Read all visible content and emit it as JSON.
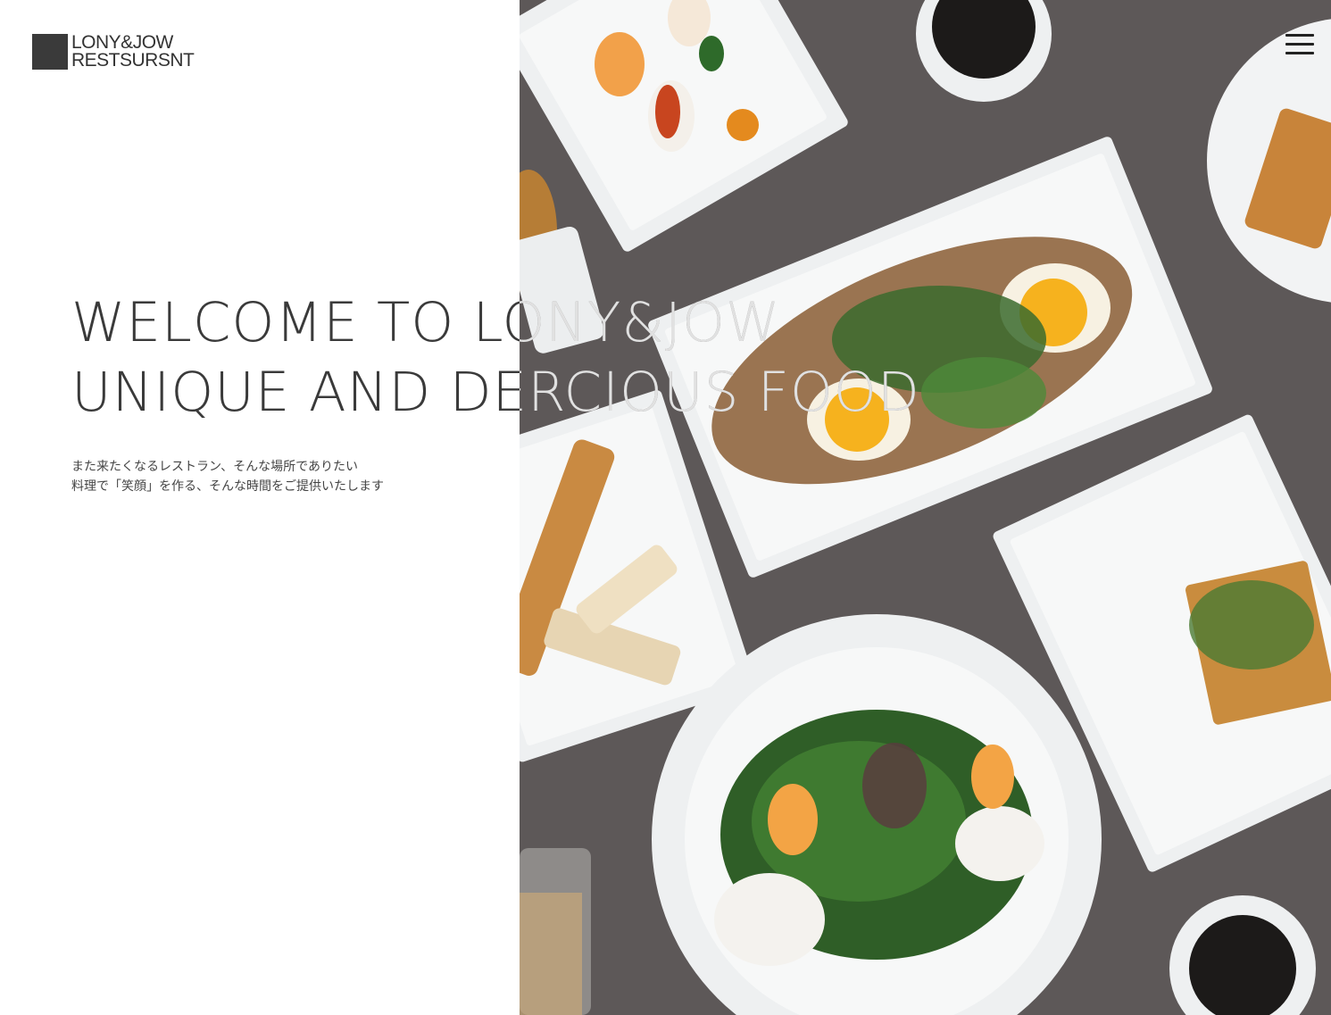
{
  "logo": {
    "line1": "LONY&JOW",
    "line2": "RESTSURSNT"
  },
  "hero": {
    "headline_line1": "WELCOME TO LONY&JOW",
    "headline_line2": "UNIQUE AND DERCIOUS FOOD",
    "tagline_line1": "また来たくなるレストラン、そんな場所でありたい",
    "tagline_line2": "料理で「笑顔」を作る、そんな時間をご提供いたします"
  },
  "menu": {
    "icon": "hamburger-menu-icon"
  },
  "colors": {
    "text": "#3a3a3a",
    "table": "#5c5858",
    "plate": "#f4f5f5"
  }
}
